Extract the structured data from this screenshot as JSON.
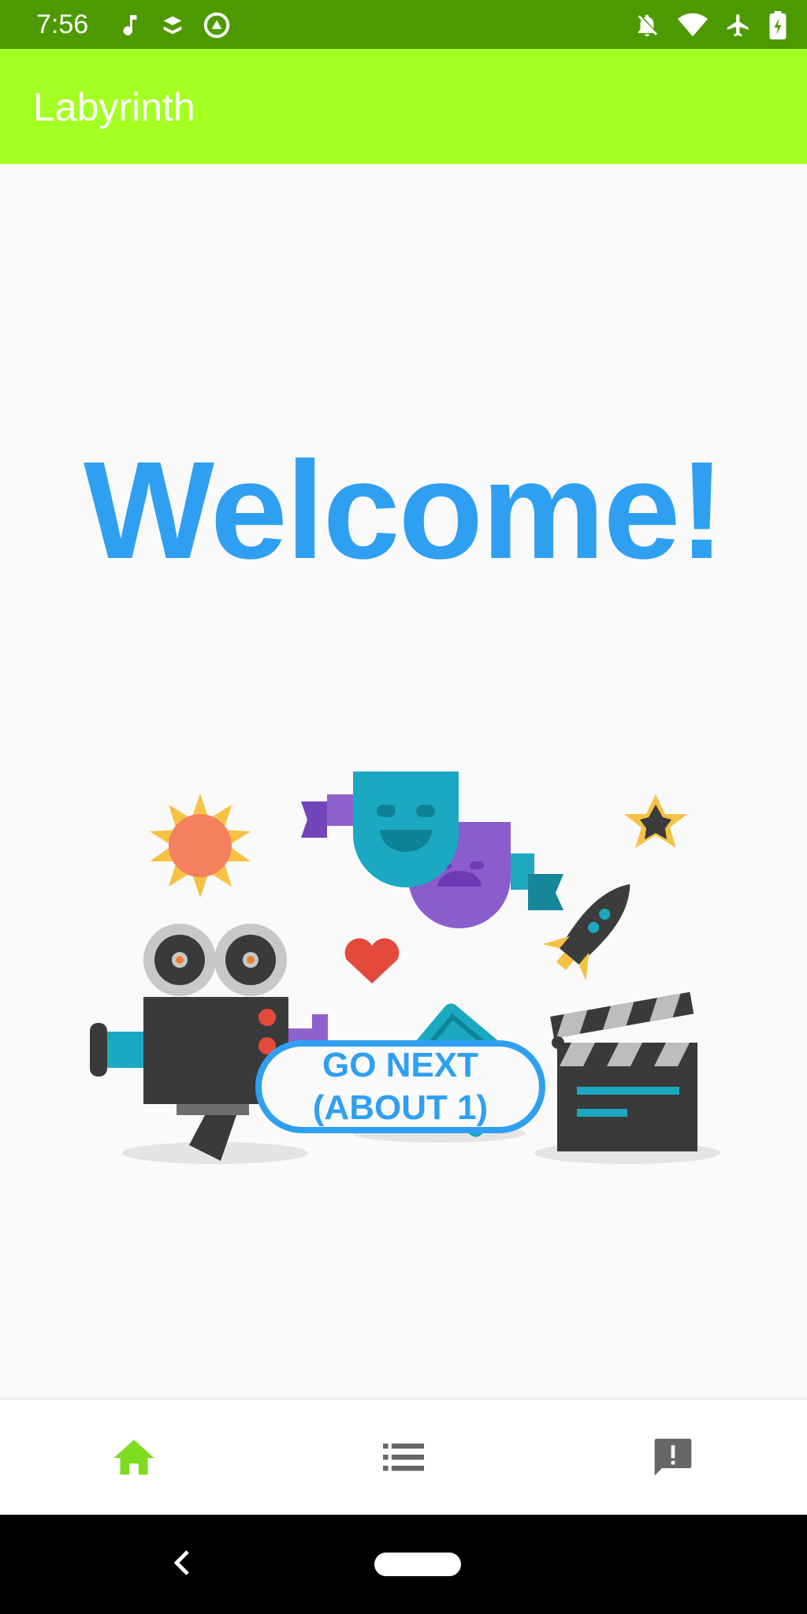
{
  "status_bar": {
    "time": "7:56",
    "left_icons": [
      "music-note-icon",
      "sync-icon",
      "assistant-icon"
    ],
    "right_icons": [
      "notifications-off-icon",
      "wifi-icon",
      "airplane-mode-icon",
      "battery-charging-icon"
    ],
    "background": "#4c9a00"
  },
  "app_bar": {
    "title": "Labyrinth",
    "background": "#a4ff22"
  },
  "main": {
    "welcome_text": "Welcome!",
    "welcome_color": "#2f9ff2",
    "illustration_icons": [
      "starburst-icon",
      "theater-masks-icon",
      "star-icon",
      "movie-camera-icon",
      "heart-icon",
      "rocket-icon",
      "tickets-icon",
      "clapperboard-icon"
    ],
    "next_button_label": "GO NEXT\n(ABOUT 1)"
  },
  "bottom_nav": {
    "items": [
      {
        "icon": "home-icon",
        "active": true,
        "color": "#7ddc1f"
      },
      {
        "icon": "list-icon",
        "active": false,
        "color": "#666666"
      },
      {
        "icon": "feedback-icon",
        "active": false,
        "color": "#666666"
      }
    ]
  },
  "system_nav": {
    "back": "back-icon",
    "home": "home-pill"
  }
}
